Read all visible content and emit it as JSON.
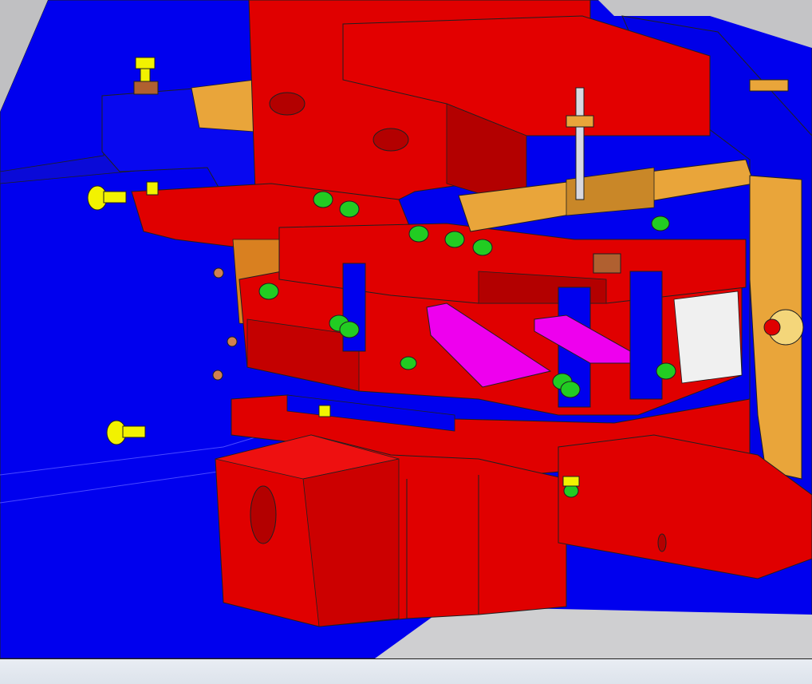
{
  "window": {
    "type": "3d-cad-viewport"
  },
  "model": {
    "description_hidden": true,
    "colors": {
      "base_plate": "#0000ee",
      "die_blocks": "#e00000",
      "block_shadow": "#b30000",
      "bracket": "#e9a53a",
      "bracket_dark": "#c98728",
      "bolt": "#22cc22",
      "bolt_dark": "#119911",
      "fastener": "#f2f200",
      "fastener_dark": "#c8c800",
      "insert": "#ee00ee",
      "insert_dark": "#b000b0",
      "edge": "#202020",
      "background": "#c8c8ca"
    }
  },
  "statusbar": {}
}
